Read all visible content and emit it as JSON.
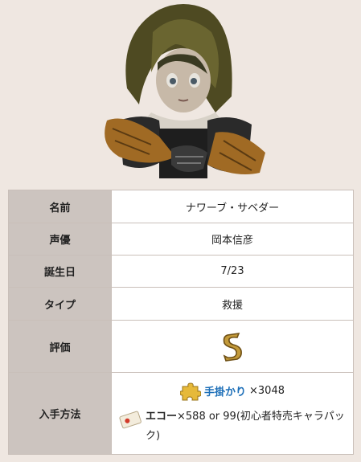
{
  "character": {
    "rows": [
      {
        "label": "名前",
        "value": "ナワーブ・サベダー"
      },
      {
        "label": "声優",
        "value": "岡本信彦"
      },
      {
        "label": "誕生日",
        "value": "7/23"
      },
      {
        "label": "タイプ",
        "value": "救援"
      },
      {
        "label": "評価",
        "value": "S",
        "icon": "rank-s-icon"
      }
    ],
    "acquisition": {
      "label": "入手方法",
      "clue_name": "手掛かり",
      "clue_amount": "×3048",
      "echo_name": "エコー",
      "echo_amount": "×588 or 99(初心者特売キャラパック)"
    }
  },
  "colors": {
    "label_bg": "#ccc4bf",
    "link": "#1d6fb8",
    "page_bg": "#efe7e1"
  }
}
